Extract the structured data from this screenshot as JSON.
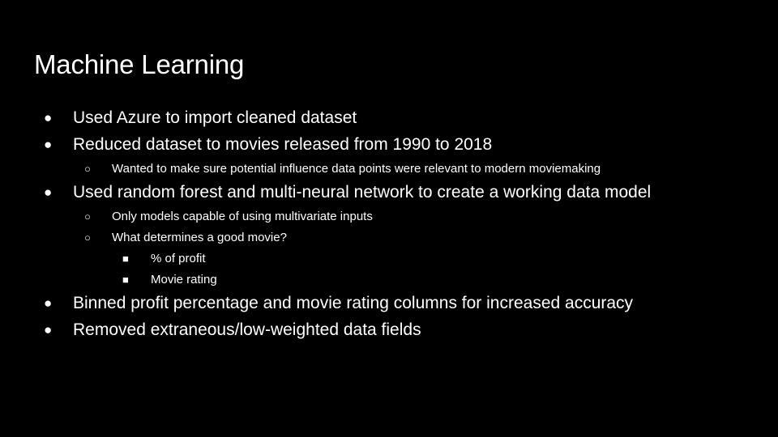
{
  "slide": {
    "title": "Machine Learning",
    "bullets": {
      "b1": {
        "marker": "●",
        "text": "Used Azure to import cleaned dataset"
      },
      "b2": {
        "marker": "●",
        "text": "Reduced dataset to movies released from 1990 to 2018"
      },
      "b2_1": {
        "marker": "○",
        "text": "Wanted to make sure potential influence data points were relevant to modern moviemaking"
      },
      "b3": {
        "marker": "●",
        "text": "Used random forest and multi-neural network to create a working data model"
      },
      "b3_1": {
        "marker": "○",
        "text": "Only models capable of using multivariate inputs"
      },
      "b3_2": {
        "marker": "○",
        "text": "What determines a good movie?"
      },
      "b3_2_1": {
        "marker": "■",
        "text": "% of profit"
      },
      "b3_2_2": {
        "marker": "■",
        "text": "Movie rating"
      },
      "b4": {
        "marker": "●",
        "text": "Binned profit percentage and movie rating columns for increased accuracy"
      },
      "b5": {
        "marker": "●",
        "text": "Removed extraneous/low-weighted data fields"
      }
    }
  }
}
